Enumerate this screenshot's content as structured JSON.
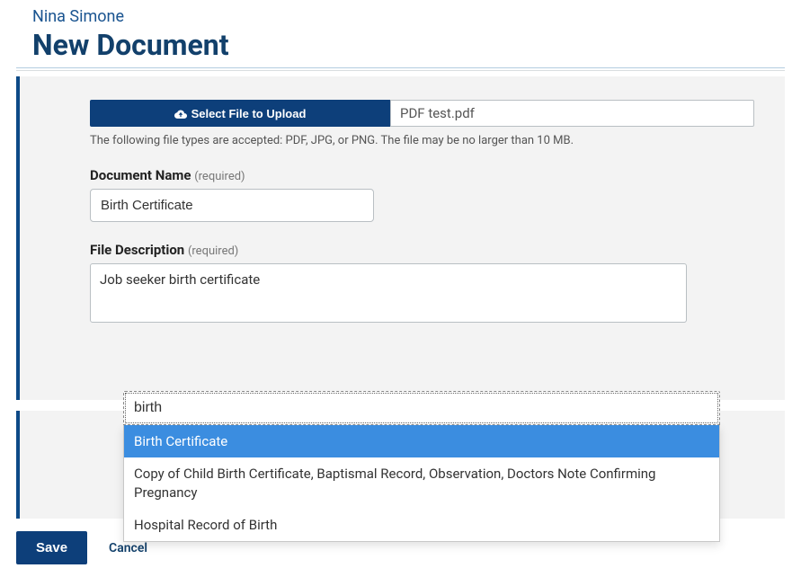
{
  "header": {
    "subtitle": "Nina Simone",
    "title": "New Document"
  },
  "upload": {
    "button_label": "Select File to Upload",
    "file_name": "PDF test.pdf",
    "hint": "The following file types are accepted: PDF, JPG, or PNG. The file may be no larger than 10 MB."
  },
  "doc_name": {
    "label": "Document Name",
    "required": "(required)",
    "value": "Birth Certificate"
  },
  "file_desc": {
    "label": "File Description",
    "required": "(required)",
    "value": "Job seeker birth certificate"
  },
  "combo": {
    "search": "birth",
    "options": [
      "Birth Certificate",
      "Copy of Child Birth Certificate, Baptismal Record, Observation, Doctors Note Confirming Pregnancy",
      "Hospital Record of Birth"
    ],
    "highlighted_index": 0
  },
  "icons": {
    "upload_icon": "cloud-upload-icon",
    "dropdown_arrow": "▲"
  },
  "actions": {
    "save": "Save",
    "cancel": "Cancel"
  }
}
